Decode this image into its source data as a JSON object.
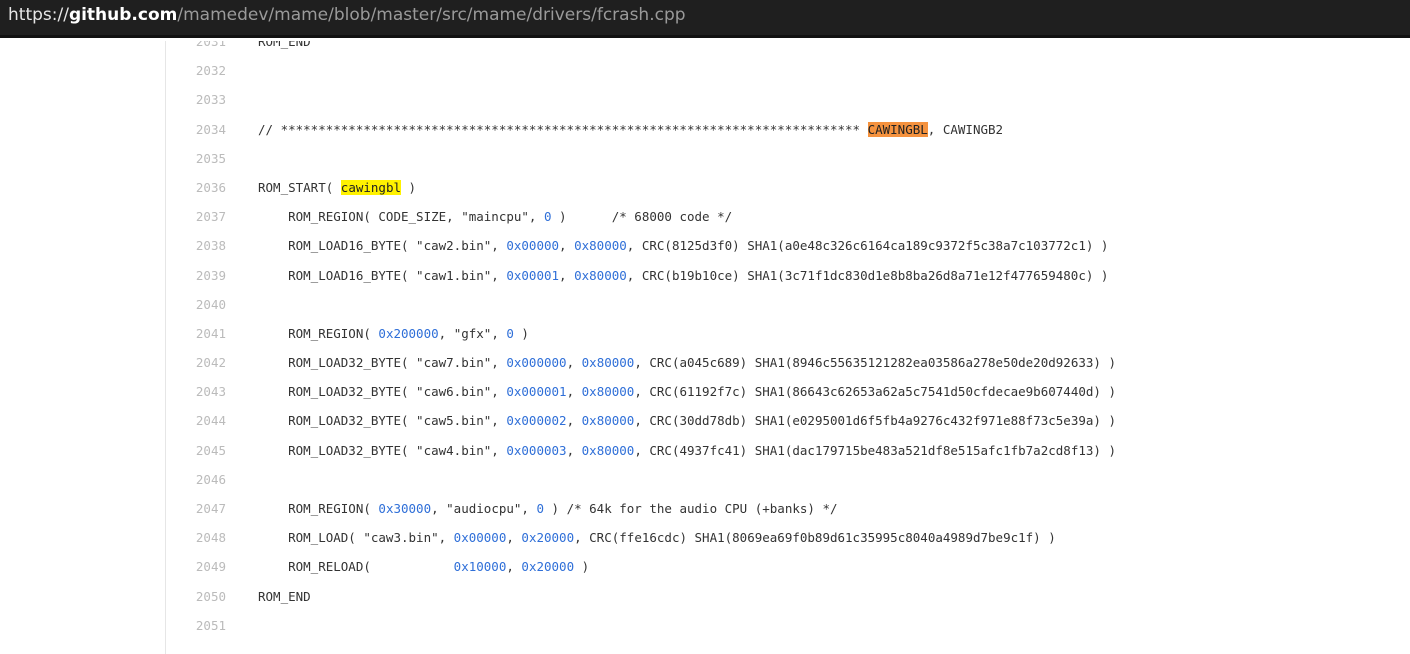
{
  "url": {
    "scheme": "https://",
    "domain": "github.com",
    "path": "/mamedev/mame/blob/master/src/mame/drivers/fcrash.cpp"
  },
  "lines": [
    {
      "n": "2031",
      "parts": [
        {
          "t": "ROM_END",
          "c": ""
        }
      ]
    },
    {
      "n": "2032",
      "parts": []
    },
    {
      "n": "2033",
      "parts": []
    },
    {
      "n": "2034",
      "parts": [
        {
          "t": "// ***************************************************************************** ",
          "c": ""
        },
        {
          "t": "CAWINGBL",
          "c": "hl-orange"
        },
        {
          "t": ", CAWINGB2",
          "c": ""
        }
      ]
    },
    {
      "n": "2035",
      "parts": []
    },
    {
      "n": "2036",
      "parts": [
        {
          "t": "ROM_START( ",
          "c": ""
        },
        {
          "t": "cawingbl",
          "c": "hl-yellow"
        },
        {
          "t": " )",
          "c": ""
        }
      ]
    },
    {
      "n": "2037",
      "parts": [
        {
          "t": "    ROM_REGION( CODE_SIZE, \"maincpu\", ",
          "c": ""
        },
        {
          "t": "0",
          "c": "num"
        },
        {
          "t": " )      /* 68000 code */",
          "c": ""
        }
      ]
    },
    {
      "n": "2038",
      "parts": [
        {
          "t": "    ROM_LOAD16_BYTE( \"caw2.bin\", ",
          "c": ""
        },
        {
          "t": "0x00000",
          "c": "num"
        },
        {
          "t": ", ",
          "c": ""
        },
        {
          "t": "0x80000",
          "c": "num"
        },
        {
          "t": ", CRC(8125d3f0) SHA1(a0e48c326c6164ca189c9372f5c38a7c103772c1) )",
          "c": ""
        }
      ]
    },
    {
      "n": "2039",
      "parts": [
        {
          "t": "    ROM_LOAD16_BYTE( \"caw1.bin\", ",
          "c": ""
        },
        {
          "t": "0x00001",
          "c": "num"
        },
        {
          "t": ", ",
          "c": ""
        },
        {
          "t": "0x80000",
          "c": "num"
        },
        {
          "t": ", CRC(b19b10ce) SHA1(3c71f1dc830d1e8b8ba26d8a71e12f477659480c) )",
          "c": ""
        }
      ]
    },
    {
      "n": "2040",
      "parts": []
    },
    {
      "n": "2041",
      "parts": [
        {
          "t": "    ROM_REGION( ",
          "c": ""
        },
        {
          "t": "0x200000",
          "c": "num"
        },
        {
          "t": ", \"gfx\", ",
          "c": ""
        },
        {
          "t": "0",
          "c": "num"
        },
        {
          "t": " )",
          "c": ""
        }
      ]
    },
    {
      "n": "2042",
      "parts": [
        {
          "t": "    ROM_LOAD32_BYTE( \"caw7.bin\", ",
          "c": ""
        },
        {
          "t": "0x000000",
          "c": "num"
        },
        {
          "t": ", ",
          "c": ""
        },
        {
          "t": "0x80000",
          "c": "num"
        },
        {
          "t": ", CRC(a045c689) SHA1(8946c55635121282ea03586a278e50de20d92633) )",
          "c": ""
        }
      ]
    },
    {
      "n": "2043",
      "parts": [
        {
          "t": "    ROM_LOAD32_BYTE( \"caw6.bin\", ",
          "c": ""
        },
        {
          "t": "0x000001",
          "c": "num"
        },
        {
          "t": ", ",
          "c": ""
        },
        {
          "t": "0x80000",
          "c": "num"
        },
        {
          "t": ", CRC(61192f7c) SHA1(86643c62653a62a5c7541d50cfdecae9b607440d) )",
          "c": ""
        }
      ]
    },
    {
      "n": "2044",
      "parts": [
        {
          "t": "    ROM_LOAD32_BYTE( \"caw5.bin\", ",
          "c": ""
        },
        {
          "t": "0x000002",
          "c": "num"
        },
        {
          "t": ", ",
          "c": ""
        },
        {
          "t": "0x80000",
          "c": "num"
        },
        {
          "t": ", CRC(30dd78db) SHA1(e0295001d6f5fb4a9276c432f971e88f73c5e39a) )",
          "c": ""
        }
      ]
    },
    {
      "n": "2045",
      "parts": [
        {
          "t": "    ROM_LOAD32_BYTE( \"caw4.bin\", ",
          "c": ""
        },
        {
          "t": "0x000003",
          "c": "num"
        },
        {
          "t": ", ",
          "c": ""
        },
        {
          "t": "0x80000",
          "c": "num"
        },
        {
          "t": ", CRC(4937fc41) SHA1(dac179715be483a521df8e515afc1fb7a2cd8f13) )",
          "c": ""
        }
      ]
    },
    {
      "n": "2046",
      "parts": []
    },
    {
      "n": "2047",
      "parts": [
        {
          "t": "    ROM_REGION( ",
          "c": ""
        },
        {
          "t": "0x30000",
          "c": "num"
        },
        {
          "t": ", \"audiocpu\", ",
          "c": ""
        },
        {
          "t": "0",
          "c": "num"
        },
        {
          "t": " ) /* 64k for the audio CPU (+banks) */",
          "c": ""
        }
      ]
    },
    {
      "n": "2048",
      "parts": [
        {
          "t": "    ROM_LOAD( \"caw3.bin\", ",
          "c": ""
        },
        {
          "t": "0x00000",
          "c": "num"
        },
        {
          "t": ", ",
          "c": ""
        },
        {
          "t": "0x20000",
          "c": "num"
        },
        {
          "t": ", CRC(ffe16cdc) SHA1(8069ea69f0b89d61c35995c8040a4989d7be9c1f) )",
          "c": ""
        }
      ]
    },
    {
      "n": "2049",
      "parts": [
        {
          "t": "    ROM_RELOAD(           ",
          "c": ""
        },
        {
          "t": "0x10000",
          "c": "num"
        },
        {
          "t": ", ",
          "c": ""
        },
        {
          "t": "0x20000",
          "c": "num"
        },
        {
          "t": " )",
          "c": ""
        }
      ]
    },
    {
      "n": "2050",
      "parts": [
        {
          "t": "ROM_END",
          "c": ""
        }
      ]
    },
    {
      "n": "2051",
      "parts": []
    }
  ]
}
